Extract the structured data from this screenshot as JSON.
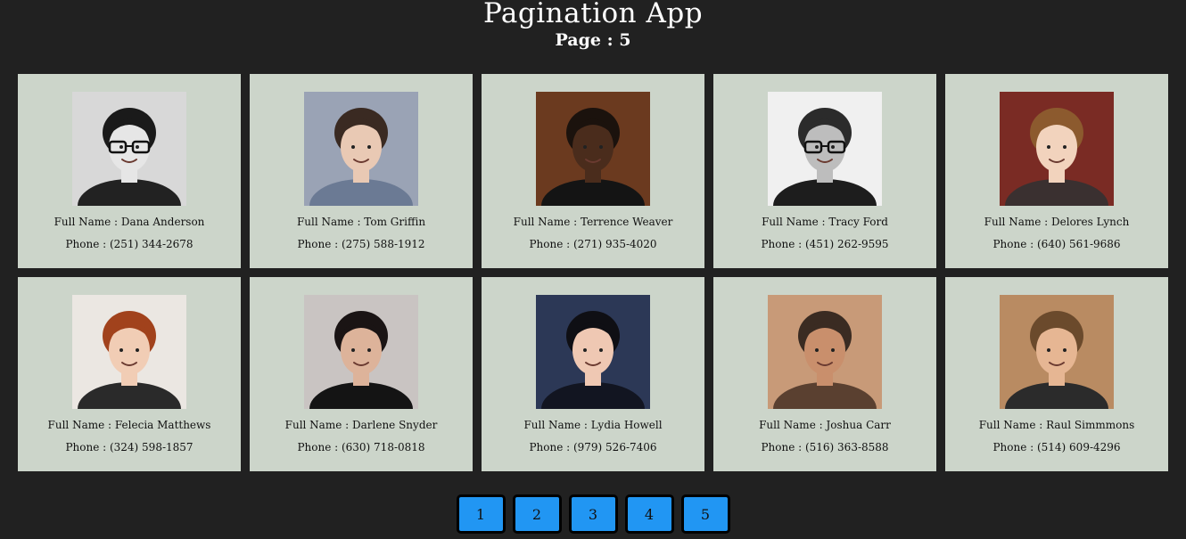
{
  "app": {
    "title": "Pagination App",
    "page_label": "Page : 5"
  },
  "users": [
    {
      "name": "Full Name : Dana Anderson",
      "phone": "Phone : (251) 344-2678",
      "bg": "#d8d8d8",
      "hair": "#1a1a1a",
      "skin": "#e6e6e6",
      "shirt": "#222222",
      "glasses": true
    },
    {
      "name": "Full Name : Tom Griffin",
      "phone": "Phone : (275) 588-1912",
      "bg": "#9aa3b5",
      "hair": "#3a2a22",
      "skin": "#e9c9b4",
      "shirt": "#6b7a94",
      "glasses": false
    },
    {
      "name": "Full Name : Terrence Weaver",
      "phone": "Phone : (271) 935-4020",
      "bg": "#6b3a1f",
      "hair": "#1b120d",
      "skin": "#4a2c1c",
      "shirt": "#141414",
      "glasses": false
    },
    {
      "name": "Full Name : Tracy Ford",
      "phone": "Phone : (451) 262-9595",
      "bg": "#f0f0f0",
      "hair": "#2b2b2b",
      "skin": "#bdbdbd",
      "shirt": "#1d1d1d",
      "glasses": true
    },
    {
      "name": "Full Name : Delores Lynch",
      "phone": "Phone : (640) 561-9686",
      "bg": "#7a2b24",
      "hair": "#8c5a2e",
      "skin": "#f2d3bd",
      "shirt": "#3a3030",
      "glasses": false
    },
    {
      "name": "Full Name : Felecia Matthews",
      "phone": "Phone : (324) 598-1857",
      "bg": "#ebe7e2",
      "hair": "#a1421c",
      "skin": "#f1cdb5",
      "shirt": "#2a2a2a",
      "glasses": false
    },
    {
      "name": "Full Name : Darlene Snyder",
      "phone": "Phone : (630) 718-0818",
      "bg": "#c9c4c2",
      "hair": "#1a1414",
      "skin": "#ddb39a",
      "shirt": "#141414",
      "glasses": false
    },
    {
      "name": "Full Name : Lydia Howell",
      "phone": "Phone : (979) 526-7406",
      "bg": "#2c3856",
      "hair": "#0f0f14",
      "skin": "#efc8b3",
      "shirt": "#121521",
      "glasses": false
    },
    {
      "name": "Full Name : Joshua Carr",
      "phone": "Phone : (516) 363-8588",
      "bg": "#c89a78",
      "hair": "#3a2b22",
      "skin": "#c98f6c",
      "shirt": "#5a4030",
      "glasses": false
    },
    {
      "name": "Full Name : Raul Simmmons",
      "phone": "Phone : (514) 609-4296",
      "bg": "#b98b62",
      "hair": "#6b4a2c",
      "skin": "#e6b693",
      "shirt": "#2b2b2b",
      "glasses": false
    }
  ],
  "pagination": {
    "pages": [
      "1",
      "2",
      "3",
      "4",
      "5"
    ],
    "button_color": "#2196f3"
  },
  "colors": {
    "background": "#212121",
    "card": "#ccd5ca"
  }
}
